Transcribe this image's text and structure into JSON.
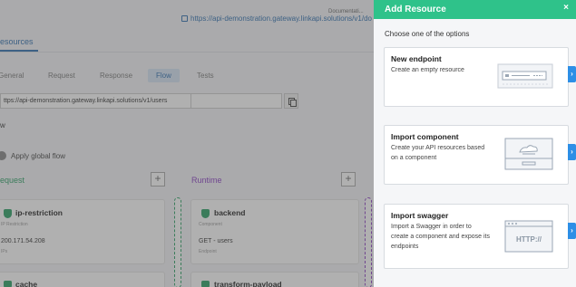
{
  "background": {
    "documentation_label": "Documentati...",
    "documentation_url": "https://api-demonstration.gateway.linkapi.solutions/v1/do",
    "tab_resources": "esources",
    "sub_tabs": [
      "General",
      "Request",
      "Response",
      "Flow",
      "Tests"
    ],
    "active_sub_tab": "Flow",
    "url_value": "ttps://api-demonstration.gateway.linkapi.solutions/v1/users",
    "w_label": "w",
    "apply_global_flow": "Apply global flow",
    "columns": {
      "request": "equest",
      "runtime": "Runtime"
    },
    "plus": "+",
    "cards": {
      "ip_restriction": {
        "title": "ip-restriction",
        "sub": "IP Restriction",
        "value": "200.171.54.208",
        "value_sub": "IPs"
      },
      "backend": {
        "title": "backend",
        "sub": "Component",
        "value": "GET - users",
        "value_sub": "Endpoint"
      },
      "cache": {
        "title": "cache"
      },
      "transform_payload": {
        "title": "transform-payload"
      }
    }
  },
  "panel": {
    "title": "Add Resource",
    "close": "×",
    "subtitle": "Choose one of the options",
    "options": [
      {
        "title": "New endpoint",
        "desc": "Create an empty resource",
        "arrow": "›"
      },
      {
        "title": "Import component",
        "desc": "Create your API resources based on a component",
        "arrow": "›"
      },
      {
        "title": "Import swagger",
        "desc": "Import a Swagger in order to create a component and expose its endpoints",
        "arrow": "›",
        "illus_text": "HTTP://"
      }
    ]
  },
  "colors": {
    "header": "#2fc28a",
    "arrow": "#2d8fe6",
    "request": "#2aa065",
    "runtime": "#8a3fc4"
  }
}
